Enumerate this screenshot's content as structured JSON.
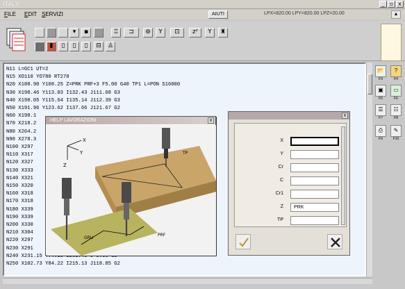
{
  "app": {
    "title": "ITALY"
  },
  "window_buttons": {
    "minimize": "_",
    "restore": "▫",
    "close": "x"
  },
  "menu": {
    "file": "FILE",
    "edit": "EDIT",
    "servizi": "SERVIZI",
    "aiuti": "AIUTI"
  },
  "coords": "LPX=820.00 LPY=820.00 LPZ=20.00",
  "toolbar": {
    "row1": [
      "",
      "",
      "",
      "",
      "",
      "",
      "",
      "",
      "",
      "",
      "",
      "",
      "",
      ""
    ],
    "row2": [
      "",
      "",
      "",
      "",
      "",
      "",
      "",
      "",
      "",
      "",
      "",
      "",
      "",
      ""
    ]
  },
  "editor_lines": [
    "N11 L=GC1 UT=2",
    "N15 XO110 YO780 RT270",
    "N20 X188.90 Y108.25 Z=PRK PRF+3 F5.00 G40 TP1 L=PON S16000",
    "N30 X198.46 Y113.03 I132.43 J111.68 G3",
    "N40 X198.05 Y115.64 I135.14 J112.39 G3",
    "N50 X191.96 Y123.62 I137.66 J121.67 G2",
    "N60 X198.1",
    "N70 X218.2",
    "N80 X264.2",
    "N90 X278.3",
    "N100 X297",
    "N110 X317",
    "N120 X327",
    "N130 X333",
    "N140 X321",
    "N150 X320",
    "N160 X318",
    "N170 X318",
    "N180 X339",
    "N190 X339",
    "N200 X330",
    "N210 X304",
    "N220 X297",
    "N230 X291",
    "N240 X231.15 Y74.10 I261.45 J-9.60 G3",
    "N250 X102.73 Y84.22 I215.13 J118.85 G2"
  ],
  "help_window": {
    "title": "HELP LAVORAZIONI",
    "labels": {
      "x": "X",
      "y": "Y",
      "z": "Z",
      "tp": "TP",
      "gru": "GRU",
      "prf": "PRF"
    }
  },
  "param_panel": {
    "rows": [
      {
        "label": "X",
        "value": ""
      },
      {
        "label": "Y",
        "value": ""
      },
      {
        "label": "Cr",
        "value": ""
      },
      {
        "label": "C",
        "value": ""
      },
      {
        "label": "Cr1",
        "value": ""
      },
      {
        "label": "Z",
        "value": "PRK"
      },
      {
        "label": "TP",
        "value": ""
      }
    ]
  },
  "side_icons": [
    "F3",
    "F4",
    "F5",
    "F6",
    "F7",
    "F8",
    "F9",
    "F10"
  ],
  "colors": {
    "editor_bg": "#eef4fb",
    "title_bar": "#b9a7a5",
    "window_bg": "#c8c8c8"
  }
}
